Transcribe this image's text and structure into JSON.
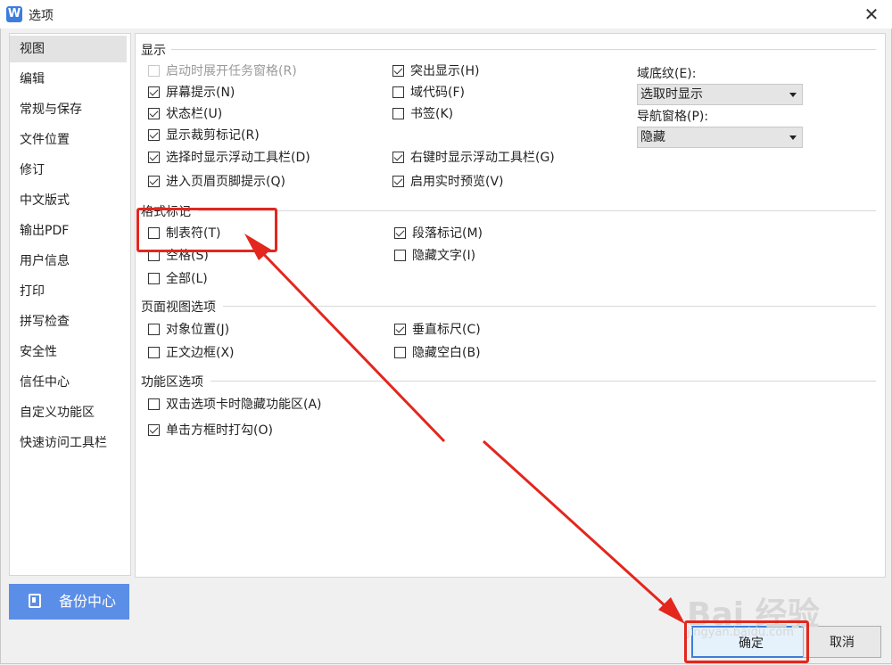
{
  "window": {
    "app_icon": "W",
    "title": "选项",
    "close": "✕"
  },
  "sidebar": {
    "items": [
      {
        "label": "视图"
      },
      {
        "label": "编辑"
      },
      {
        "label": "常规与保存"
      },
      {
        "label": "文件位置"
      },
      {
        "label": "修订"
      },
      {
        "label": "中文版式"
      },
      {
        "label": "输出PDF"
      },
      {
        "label": "用户信息"
      },
      {
        "label": "打印"
      },
      {
        "label": "拼写检查"
      },
      {
        "label": "安全性"
      },
      {
        "label": "信任中心"
      },
      {
        "label": "自定义功能区"
      },
      {
        "label": "快速访问工具栏"
      }
    ],
    "active": "视图"
  },
  "backup_button": {
    "label": "备份中心"
  },
  "sections": {
    "display": {
      "title": "显示",
      "options": [
        {
          "label": "启动时展开任务窗格(R)",
          "checked": false,
          "disabled": true
        },
        {
          "label": "屏幕提示(N)",
          "checked": true
        },
        {
          "label": "状态栏(U)",
          "checked": true
        },
        {
          "label": "显示裁剪标记(R)",
          "checked": true
        },
        {
          "label": "选择时显示浮动工具栏(D)",
          "checked": true
        },
        {
          "label": "进入页眉页脚提示(Q)",
          "checked": true
        },
        {
          "label": "突出显示(H)",
          "checked": true
        },
        {
          "label": "域代码(F)",
          "checked": false
        },
        {
          "label": "书签(K)",
          "checked": false
        },
        {
          "label": "右键时显示浮动工具栏(G)",
          "checked": true
        },
        {
          "label": "启用实时预览(V)",
          "checked": true
        }
      ],
      "field_shading": {
        "label": "域底纹(E):",
        "value": "选取时显示"
      },
      "nav_pane": {
        "label": "导航窗格(P):",
        "value": "隐藏"
      }
    },
    "format_marks": {
      "title": "格式标记",
      "options": [
        {
          "label": "制表符(T)",
          "checked": false
        },
        {
          "label": "空格(S)",
          "checked": false
        },
        {
          "label": "全部(L)",
          "checked": false
        },
        {
          "label": "段落标记(M)",
          "checked": true
        },
        {
          "label": "隐藏文字(I)",
          "checked": false
        }
      ]
    },
    "page_view": {
      "title": "页面视图选项",
      "options": [
        {
          "label": "对象位置(J)",
          "checked": false
        },
        {
          "label": "正文边框(X)",
          "checked": false
        },
        {
          "label": "垂直标尺(C)",
          "checked": true
        },
        {
          "label": "隐藏空白(B)",
          "checked": false
        }
      ]
    },
    "ribbon": {
      "title": "功能区选项",
      "options": [
        {
          "label": "双击选项卡时隐藏功能区(A)",
          "checked": false
        },
        {
          "label": "单击方框时打勾(O)",
          "checked": true
        }
      ]
    }
  },
  "footer": {
    "ok": "确定",
    "cancel": "取消"
  },
  "annotation": {
    "color": "#e3261e"
  },
  "watermark": {
    "brand": "Bai 经验",
    "url": "jingyan.baidu.com"
  }
}
